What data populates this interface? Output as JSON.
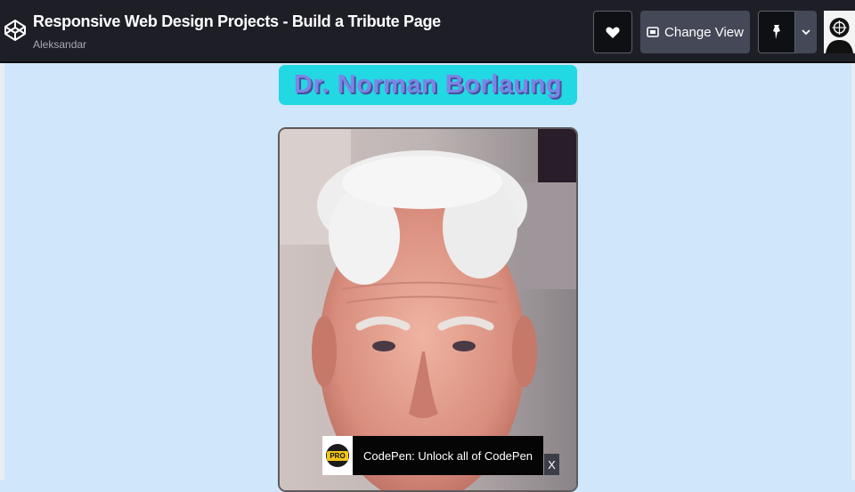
{
  "header": {
    "title": "Responsive Web Design Projects - Build a Tribute Page",
    "author": "Aleksandar",
    "logo_icon": "codepen-icon"
  },
  "toolbar": {
    "like_icon": "heart-icon",
    "change_view_label": "Change View",
    "change_view_icon": "layout-icon",
    "pin_icon": "pin-icon",
    "menu_icon": "chevron-down-icon",
    "avatar": "user-avatar"
  },
  "preview": {
    "heading": "Dr. Norman Borlaung",
    "photo": "portrait-photo"
  },
  "toast": {
    "badge": "PRO",
    "text": "CodePen: Unlock all of CodePen",
    "close": "X"
  },
  "colors": {
    "header_bg": "#1e1f26",
    "page_bg": "#cfe6fb",
    "banner_bg": "#22d8e2",
    "banner_text": "#7c84e6"
  }
}
